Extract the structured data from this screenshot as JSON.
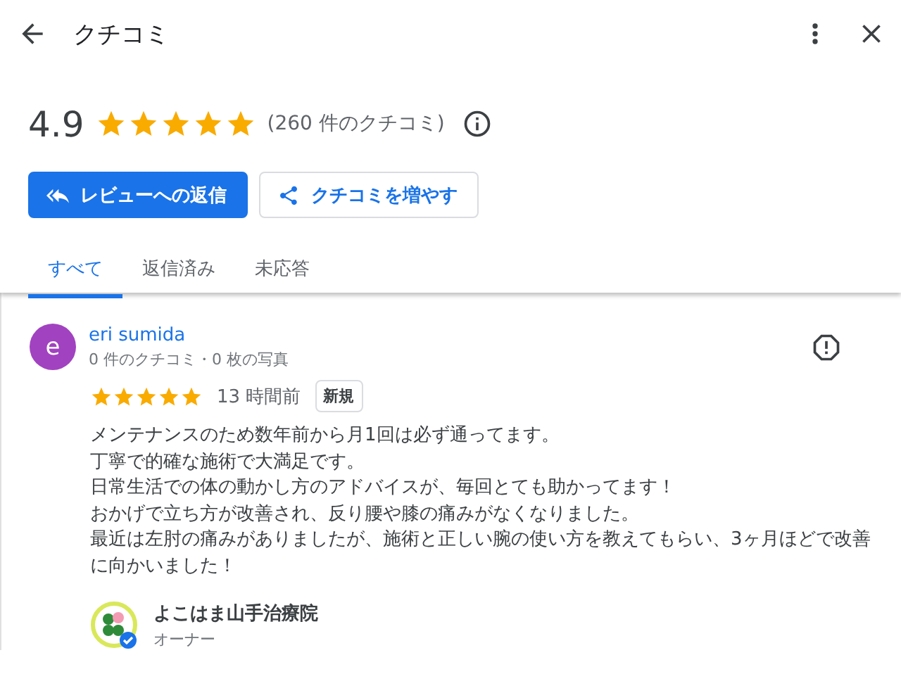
{
  "app_bar": {
    "title": "クチコミ"
  },
  "summary": {
    "rating": "4.9",
    "stars": 5,
    "count": "(260 件のクチコミ)"
  },
  "buttons": [
    {
      "kind": "primary",
      "label": "レビューへの返信"
    },
    {
      "kind": "outline",
      "label": "クチコミを増やす"
    }
  ],
  "tabs": [
    {
      "label": "すべて",
      "selected": true
    },
    {
      "label": "返信済み",
      "selected": false
    },
    {
      "label": "未応答",
      "selected": false
    }
  ],
  "review": {
    "initial": "e",
    "name": "eri sumida",
    "stats": "0 件のクチコミ・0 枚の写真",
    "stars": 5,
    "time": "13 時間前",
    "badge": "新規",
    "text_lines": [
      "メンテナンスのため数年前から月1回は必ず通ってます。",
      "丁寧で的確な施術で大満足です。",
      "日常生活での体の動かし方のアドバイスが、毎回とても助かってます！",
      "おかげで立ち方が改善され、反り腰や膝の痛みがなくなりました。",
      "最近は左肘の痛みがありましたが、施術と正しい腕の使い方を教えてもらい、3ヶ月ほどで改善に向かいました！"
    ],
    "owner": {
      "name": "よこはま山手治療院",
      "role": "オーナー"
    }
  }
}
